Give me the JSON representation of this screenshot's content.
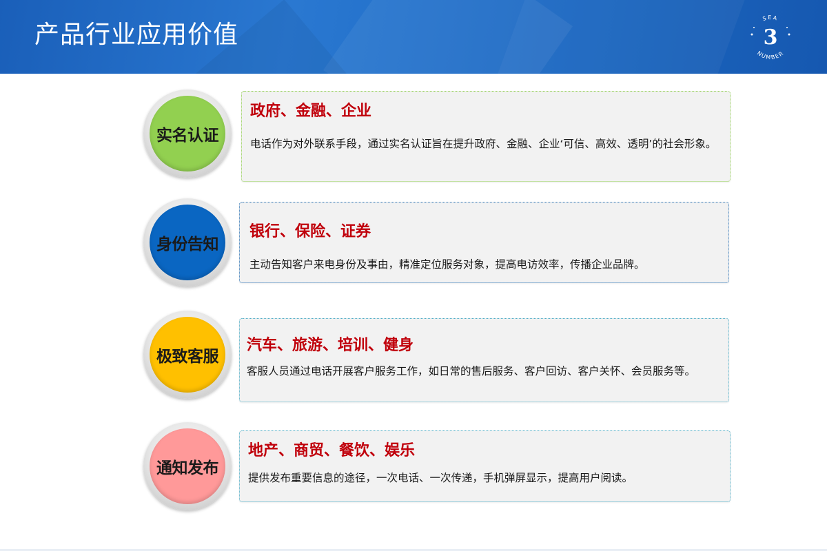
{
  "header": {
    "title": "产品行业应用价值",
    "logo": {
      "top_text": "SEA",
      "bottom_text": "NUMBER",
      "glyph": "3",
      "color": "#ffffff"
    },
    "background_color": "#1e6cc6"
  },
  "rows": [
    {
      "badge_label": "实名认证",
      "badge_color": "#92d050",
      "title": "政府、金融、企业",
      "description": "电话作为对外联系手段，通过实名认证旨在提升政府、金融、企业‘可信、高效、透明’的社会形象。",
      "border_color": "#92d050"
    },
    {
      "badge_label": "身份告知",
      "badge_color": "#0a66c2",
      "title": "银行、保险、证券",
      "description": "主动告知客户来电身份及事由，精准定位服务对象，提高电访效率，传播企业品牌。",
      "border_color": "#2e75b6"
    },
    {
      "badge_label": "极致客服",
      "badge_color": "#ffc000",
      "title": "汽车、旅游、培训、健身",
      "description": "客服人员通过电话开展客户服务工作，如日常的售后服务、客户回访、客户关怀、会员服务等。",
      "border_color": "#4bacc6"
    },
    {
      "badge_label": "通知发布",
      "badge_color": "#ff9999",
      "title": "地产、商贸、餐饮、娱乐",
      "description": "提供发布重要信息的途径，一次电话、一次传递，手机弹屏显示，提高用户阅读。",
      "border_color": "#4bacc6"
    }
  ],
  "colors": {
    "title_red": "#c0000b",
    "card_bg": "#f2f2f2"
  }
}
